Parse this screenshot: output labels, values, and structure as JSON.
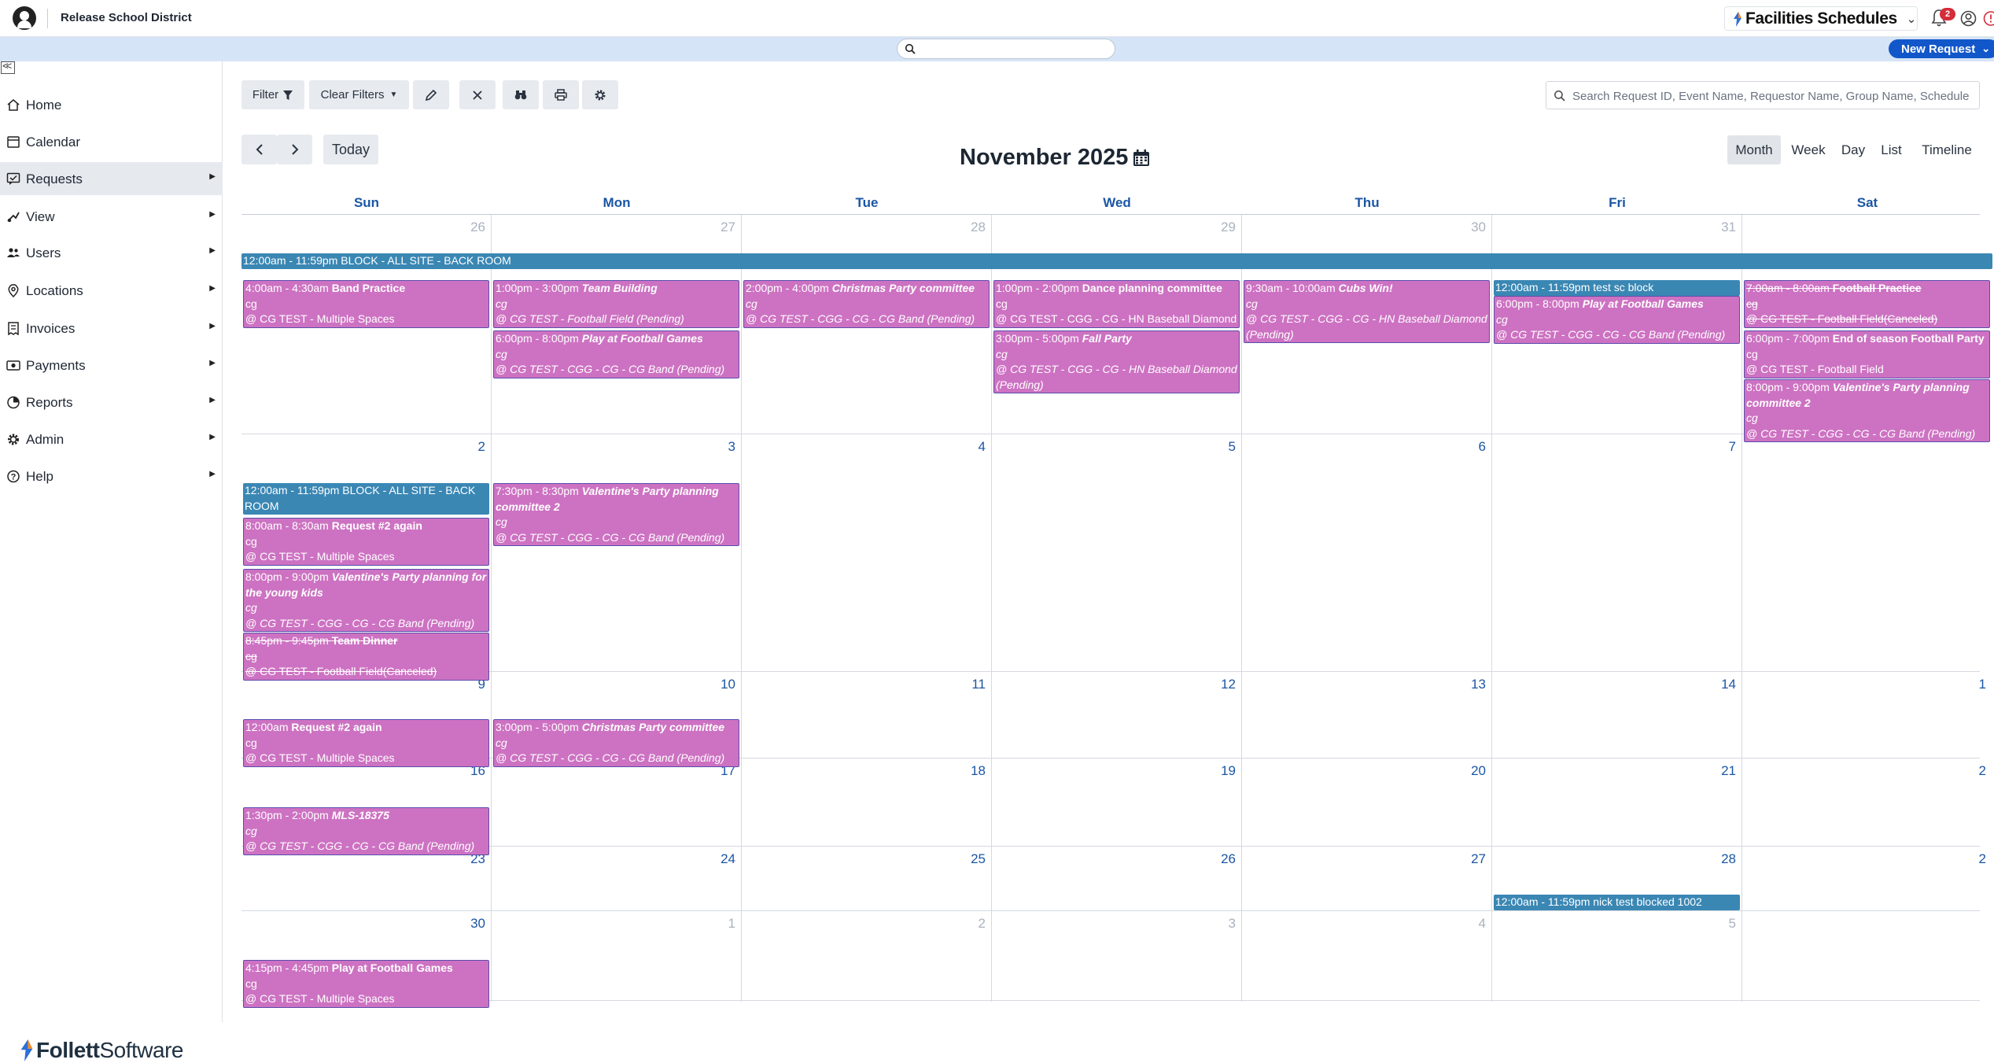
{
  "header": {
    "district": "Release School District",
    "product": "Facilities Schedules",
    "notification_count": "2"
  },
  "search": {
    "global_placeholder": "",
    "request_placeholder": "Search Request ID, Event Name, Requestor Name, Group Name, Schedule ID"
  },
  "new_request_label": "New Request",
  "sidebar": {
    "items": [
      {
        "label": "Home",
        "icon": "home-icon"
      },
      {
        "label": "Calendar",
        "icon": "calendar-icon"
      },
      {
        "label": "Requests",
        "icon": "requests-icon"
      },
      {
        "label": "View",
        "icon": "view-icon"
      },
      {
        "label": "Users",
        "icon": "users-icon"
      },
      {
        "label": "Locations",
        "icon": "location-icon"
      },
      {
        "label": "Invoices",
        "icon": "invoice-icon"
      },
      {
        "label": "Payments",
        "icon": "payment-icon"
      },
      {
        "label": "Reports",
        "icon": "reports-icon"
      },
      {
        "label": "Admin",
        "icon": "admin-icon"
      },
      {
        "label": "Help",
        "icon": "help-icon"
      }
    ],
    "brand": {
      "part1": "Follett",
      "part2": " Software"
    }
  },
  "toolbar": {
    "filter_label": "Filter",
    "clear_filters_label": "Clear Filters"
  },
  "calendar": {
    "title": "November 2025",
    "today_label": "Today",
    "views": [
      "Month",
      "Week",
      "Day",
      "List",
      "Timeline"
    ],
    "active_view": "Month",
    "day_names": [
      "Sun",
      "Mon",
      "Tue",
      "Wed",
      "Thu",
      "Fri",
      "Sat"
    ],
    "weeks": [
      {
        "days": [
          "26",
          "27",
          "28",
          "29",
          "30",
          "31",
          ""
        ],
        "other": [
          true,
          true,
          true,
          true,
          true,
          true,
          false
        ]
      },
      {
        "days": [
          "2",
          "3",
          "4",
          "5",
          "6",
          "7",
          ""
        ],
        "other": [
          false,
          false,
          false,
          false,
          false,
          false,
          false
        ]
      },
      {
        "days": [
          "9",
          "10",
          "11",
          "12",
          "13",
          "14",
          "1"
        ],
        "other": [
          false,
          false,
          false,
          false,
          false,
          false,
          false
        ]
      },
      {
        "days": [
          "16",
          "17",
          "18",
          "19",
          "20",
          "21",
          "2"
        ],
        "other": [
          false,
          false,
          false,
          false,
          false,
          false,
          false
        ]
      },
      {
        "days": [
          "23",
          "24",
          "25",
          "26",
          "27",
          "28",
          "2"
        ],
        "other": [
          false,
          false,
          false,
          false,
          false,
          false,
          false
        ]
      },
      {
        "days": [
          "30",
          "1",
          "2",
          "3",
          "4",
          "5",
          ""
        ],
        "other": [
          false,
          true,
          true,
          true,
          true,
          true,
          false
        ]
      }
    ],
    "events": [
      {
        "week": 0,
        "col": 0,
        "span": 7,
        "row": 0,
        "block": true,
        "time": "12:00am - 11:59pm",
        "title": "BLOCK - ALL SITE - BACK ROOM"
      },
      {
        "week": 0,
        "col": 0,
        "row": 1,
        "time": "4:00am - 4:30am",
        "title": "Band Practice",
        "italic": false,
        "lines": [
          "cg",
          "@ CG TEST - Multiple Spaces"
        ]
      },
      {
        "week": 0,
        "col": 1,
        "row": 1,
        "time": "1:00pm - 3:00pm",
        "title": "Team Building",
        "italic": true,
        "lines": [
          "cg",
          "@ CG TEST - Football Field (Pending)"
        ]
      },
      {
        "week": 0,
        "col": 1,
        "row": 2,
        "time": "6:00pm - 8:00pm",
        "title": "Play at Football Games",
        "italic": true,
        "lines": [
          "cg",
          "@ CG TEST - CGG - CG - CG Band (Pending)"
        ]
      },
      {
        "week": 0,
        "col": 2,
        "row": 1,
        "time": "2:00pm - 4:00pm",
        "title": "Christmas Party committee",
        "italic": true,
        "lines": [
          "cg",
          "@ CG TEST - CGG - CG - CG Band (Pending)"
        ]
      },
      {
        "week": 0,
        "col": 3,
        "row": 1,
        "time": "1:00pm - 2:00pm",
        "title": "Dance planning committee",
        "italic": false,
        "lines": [
          "cg",
          "@ CG TEST - CGG - CG - HN Baseball Diamond"
        ]
      },
      {
        "week": 0,
        "col": 3,
        "row": 2,
        "time": "3:00pm - 5:00pm",
        "title": "Fall Party",
        "italic": true,
        "lines": [
          "cg",
          "@ CG TEST - CGG - CG - HN Baseball Diamond",
          "(Pending)"
        ]
      },
      {
        "week": 0,
        "col": 4,
        "row": 1,
        "time": "9:30am - 10:00am",
        "title": "Cubs Win!",
        "italic": true,
        "lines": [
          "cg",
          "@ CG TEST - CGG - CG - HN Baseball Diamond",
          "(Pending)"
        ]
      },
      {
        "week": 0,
        "col": 5,
        "row": 1,
        "block": true,
        "time": "12:00am - 11:59pm",
        "title": "test sc block"
      },
      {
        "week": 0,
        "col": 5,
        "row": 2,
        "time": "6:00pm - 8:00pm",
        "title": "Play at Football Games",
        "italic": true,
        "lines": [
          "cg",
          "@ CG TEST - CGG - CG - CG Band (Pending)"
        ]
      },
      {
        "week": 0,
        "col": 6,
        "row": 1,
        "time": "7:00am - 8:00am",
        "title": "Football Practice",
        "canceled": true,
        "lines": [
          "cg",
          "@ CG TEST - Football Field(Canceled)"
        ]
      },
      {
        "week": 0,
        "col": 6,
        "row": 2,
        "time": "6:00pm - 7:00pm",
        "title": "End of season Football Party",
        "italic": false,
        "lines": [
          "cg",
          "@ CG TEST - Football Field"
        ]
      },
      {
        "week": 0,
        "col": 6,
        "row": 3,
        "time": "8:00pm - 9:00pm",
        "title": "Valentine's Party planning committee 2",
        "italic": true,
        "lines": [
          "cg",
          "@ CG TEST - CGG - CG - CG Band (Pending)"
        ]
      },
      {
        "week": 1,
        "col": 0,
        "row": 0,
        "block": true,
        "time": "12:00am - 11:59pm",
        "title": "BLOCK - ALL SITE - BACK ROOM"
      },
      {
        "week": 1,
        "col": 0,
        "row": 1,
        "time": "8:00am - 8:30am",
        "title": "Request #2 again",
        "italic": false,
        "lines": [
          "cg",
          "@ CG TEST - Multiple Spaces"
        ]
      },
      {
        "week": 1,
        "col": 0,
        "row": 2,
        "time": "8:00pm - 9:00pm",
        "title": "Valentine's Party planning for the young kids",
        "italic": true,
        "lines": [
          "cg",
          "@ CG TEST - CGG - CG - CG Band (Pending)"
        ]
      },
      {
        "week": 1,
        "col": 0,
        "row": 3,
        "time": "8:45pm - 9:45pm",
        "title": "Team Dinner",
        "canceled": true,
        "lines": [
          "cg",
          "@ CG TEST - Football Field(Canceled)"
        ]
      },
      {
        "week": 1,
        "col": 1,
        "row": 0,
        "time": "7:30pm - 8:30pm",
        "title": "Valentine's Party planning committee 2",
        "italic": true,
        "lines": [
          "cg",
          "@ CG TEST - CGG - CG - CG Band (Pending)"
        ]
      },
      {
        "week": 2,
        "col": 0,
        "row": 0,
        "time": "12:00am",
        "title": "Request #2 again",
        "italic": false,
        "lines": [
          "cg",
          "@ CG TEST - Multiple Spaces"
        ]
      },
      {
        "week": 2,
        "col": 1,
        "row": 0,
        "time": "3:00pm - 5:00pm",
        "title": "Christmas Party committee",
        "italic": true,
        "lines": [
          "cg",
          "@ CG TEST - CGG - CG - CG Band (Pending)"
        ]
      },
      {
        "week": 3,
        "col": 0,
        "row": 0,
        "time": "1:30pm - 2:00pm",
        "title": "MLS-18375",
        "italic": true,
        "lines": [
          "cg",
          "@ CG TEST - CGG - CG - CG Band (Pending)"
        ]
      },
      {
        "week": 4,
        "col": 5,
        "row": 0,
        "block": true,
        "time": "12:00am - 11:59pm",
        "title": "nick test blocked 1002"
      },
      {
        "week": 5,
        "col": 0,
        "row": 0,
        "time": "4:15pm - 4:45pm",
        "title": "Play at Football Games",
        "italic": false,
        "lines": [
          "cg",
          "@ CG TEST - Multiple Spaces"
        ]
      }
    ]
  }
}
